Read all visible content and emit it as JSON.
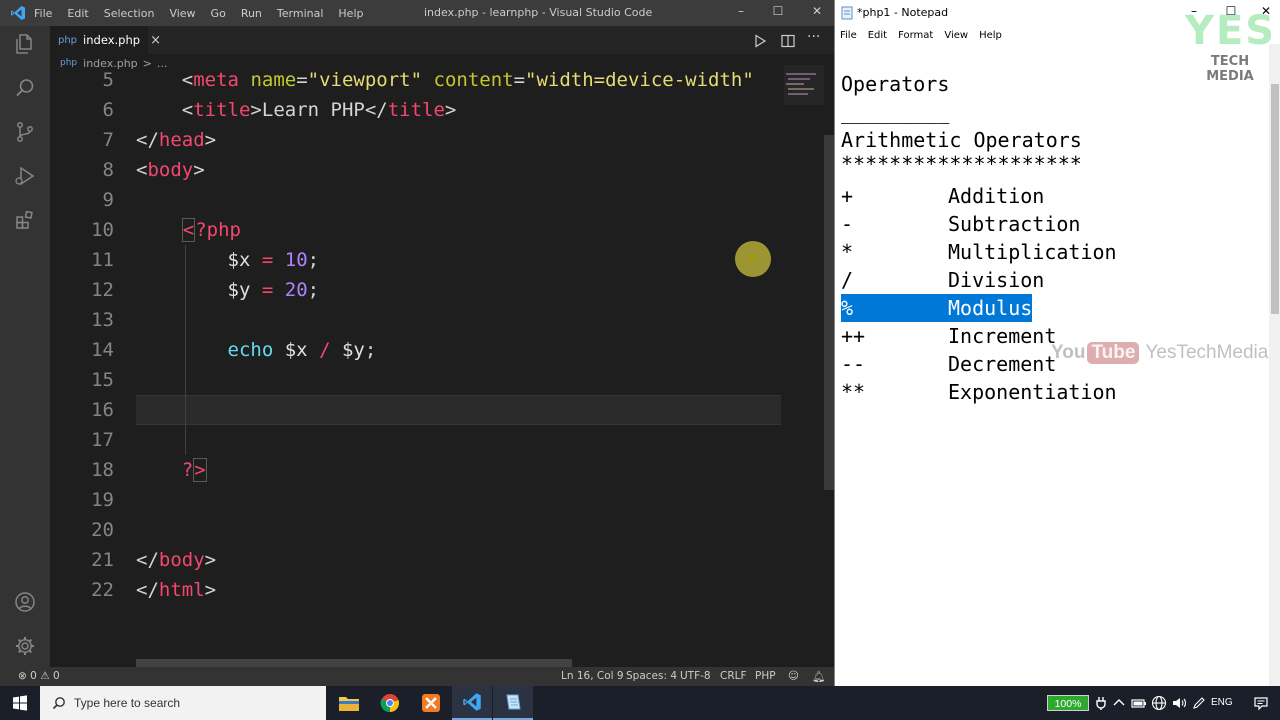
{
  "vscode": {
    "menu": [
      "File",
      "Edit",
      "Selection",
      "View",
      "Go",
      "Run",
      "Terminal",
      "Help"
    ],
    "window_title": "index.php - learnphp - Visual Studio Code",
    "tab": {
      "badge": "php",
      "label": "index.php",
      "close": "×"
    },
    "breadcrumb": {
      "badge": "php",
      "file": "index.php",
      "sep": ">",
      "more": "..."
    },
    "lines": [
      {
        "n": "5",
        "html": "    <span class='t-punc'>&lt;</span><span class='t-tag'>meta</span> <span class='t-attr'>name</span><span class='t-punc'>=</span><span class='t-str'>\"viewport\"</span> <span class='t-attr'>content</span><span class='t-punc'>=</span><span class='t-str'>\"width=device-width\"</span>"
      },
      {
        "n": "6",
        "html": "    <span class='t-punc'>&lt;</span><span class='t-tag'>title</span><span class='t-punc'>&gt;</span>Learn PHP<span class='t-punc'>&lt;/</span><span class='t-tag'>title</span><span class='t-punc'>&gt;</span>"
      },
      {
        "n": "7",
        "html": "<span class='t-punc'>&lt;/</span><span class='t-tag'>head</span><span class='t-punc'>&gt;</span>"
      },
      {
        "n": "8",
        "html": "<span class='t-punc'>&lt;</span><span class='t-tag'>body</span><span class='t-punc'>&gt;</span>"
      },
      {
        "n": "9",
        "html": ""
      },
      {
        "n": "10",
        "html": "    <span class='t-php php-open'>&lt;</span><span class='t-php'>?php</span>"
      },
      {
        "n": "11",
        "html": "        <span class='t-var'>$x</span> <span class='t-op'>=</span> <span class='t-num'>10</span><span class='t-punc'>;</span>"
      },
      {
        "n": "12",
        "html": "        <span class='t-var'>$y</span> <span class='t-op'>=</span> <span class='t-num'>20</span><span class='t-punc'>;</span>"
      },
      {
        "n": "13",
        "html": ""
      },
      {
        "n": "14",
        "html": "        <span class='t-kw'>echo</span> <span class='t-var'>$x</span> <span class='t-op'>/</span> <span class='t-var'>$y</span><span class='t-punc'>;</span>"
      },
      {
        "n": "15",
        "html": ""
      },
      {
        "n": "16",
        "html": ""
      },
      {
        "n": "17",
        "html": ""
      },
      {
        "n": "18",
        "html": "    <span class='t-php'>?</span><span class='t-php php-open'>&gt;</span>"
      },
      {
        "n": "19",
        "html": ""
      },
      {
        "n": "20",
        "html": ""
      },
      {
        "n": "21",
        "html": "<span class='t-punc'>&lt;/</span><span class='t-tag'>body</span><span class='t-punc'>&gt;</span>"
      },
      {
        "n": "22",
        "html": "<span class='t-punc'>&lt;/</span><span class='t-tag'>html</span><span class='t-punc'>&gt;</span>"
      }
    ],
    "status": {
      "problems": "0",
      "warnings": "0",
      "position": "Ln 16, Col 9",
      "spaces": "Spaces: 4",
      "encoding": "UTF-8",
      "eol": "CRLF",
      "language": "PHP"
    }
  },
  "notepad": {
    "title": "*php1 - Notepad",
    "menu": [
      "File",
      "Edit",
      "Format",
      "View",
      "Help"
    ],
    "heading": "Operators",
    "rule": "_________",
    "subheading": "Arithmetic Operators",
    "stars": "********************",
    "operators": [
      {
        "symbol": "+",
        "name": "Addition",
        "selected": false
      },
      {
        "symbol": "-",
        "name": "Subtraction",
        "selected": false
      },
      {
        "symbol": "*",
        "name": "Multiplication",
        "selected": false
      },
      {
        "symbol": "/",
        "name": "Division",
        "selected": false
      },
      {
        "symbol": "%",
        "name": "Modulus",
        "selected": true
      },
      {
        "symbol": "++",
        "name": "Increment",
        "selected": false
      },
      {
        "symbol": "--",
        "name": "Decrement",
        "selected": false
      },
      {
        "symbol": "**",
        "name": "Exponentiation",
        "selected": false
      }
    ]
  },
  "watermark": {
    "big": "YES",
    "small": "TECH MEDIA",
    "yt_you": "You",
    "yt_tube": "Tube",
    "yt_channel": "YesTechMedia"
  },
  "taskbar": {
    "search_placeholder": "Type here to search",
    "battery": "100%",
    "lang": "ENG"
  },
  "colors": {
    "selection": "#0078d7",
    "taskbar": "#1a1f29",
    "vscode_bg": "#1e1e1e",
    "tag": "#f44770"
  }
}
